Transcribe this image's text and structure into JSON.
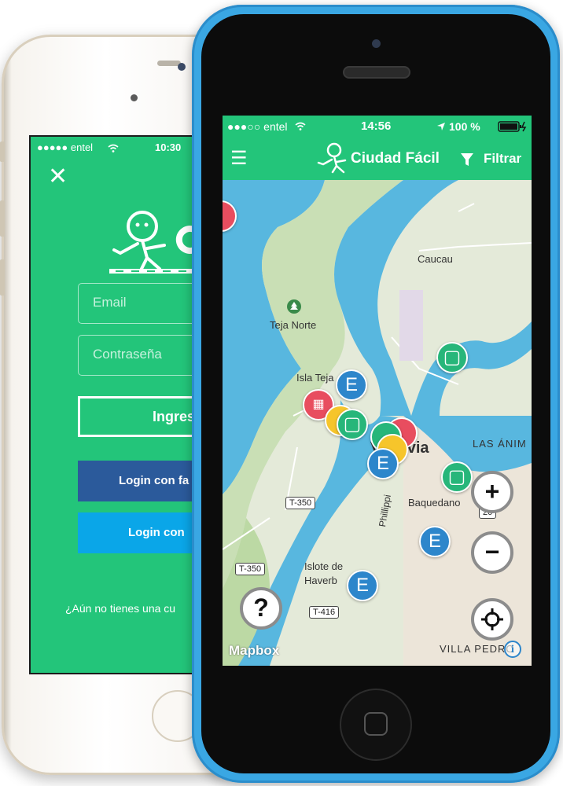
{
  "login_screen": {
    "status": {
      "carrier": "●●●●● entel",
      "time": "10:30"
    },
    "close_label": "✕",
    "email_placeholder": "Email",
    "password_placeholder": "Contraseña",
    "enter_button": "Ingres",
    "facebook_button": "Login con fa",
    "twitter_button": "Login con",
    "no_account": "¿Aún no tienes una cu"
  },
  "map_screen": {
    "status": {
      "carrier": "●●●○○ entel",
      "time": "14:56",
      "battery": "100 %"
    },
    "nav": {
      "menu_icon": "☰",
      "title": "Ciudad Fácil",
      "filter_label": "Filtrar"
    },
    "places": [
      "Caucau",
      "Teja Norte",
      "Isla Teja",
      "LAS ÁNIM",
      "Baquedano",
      "Phillippi",
      "Islote de",
      "Haverb",
      "VILLA PEDRO",
      "Valdivia"
    ],
    "roads": [
      "T-350",
      "T-350",
      "T-416",
      "20"
    ],
    "pin_letter": "E",
    "help_label": "?",
    "zoom_in_label": "+",
    "zoom_out_label": "−",
    "attribution": "Mapbox",
    "info_label": "i"
  },
  "colors": {
    "brand_green": "#23c57a",
    "facebook": "#2b5a9b",
    "twitter": "#0aa6e8",
    "pin_blue": "#2d86cb",
    "phone_blue": "#3aa7e3"
  }
}
